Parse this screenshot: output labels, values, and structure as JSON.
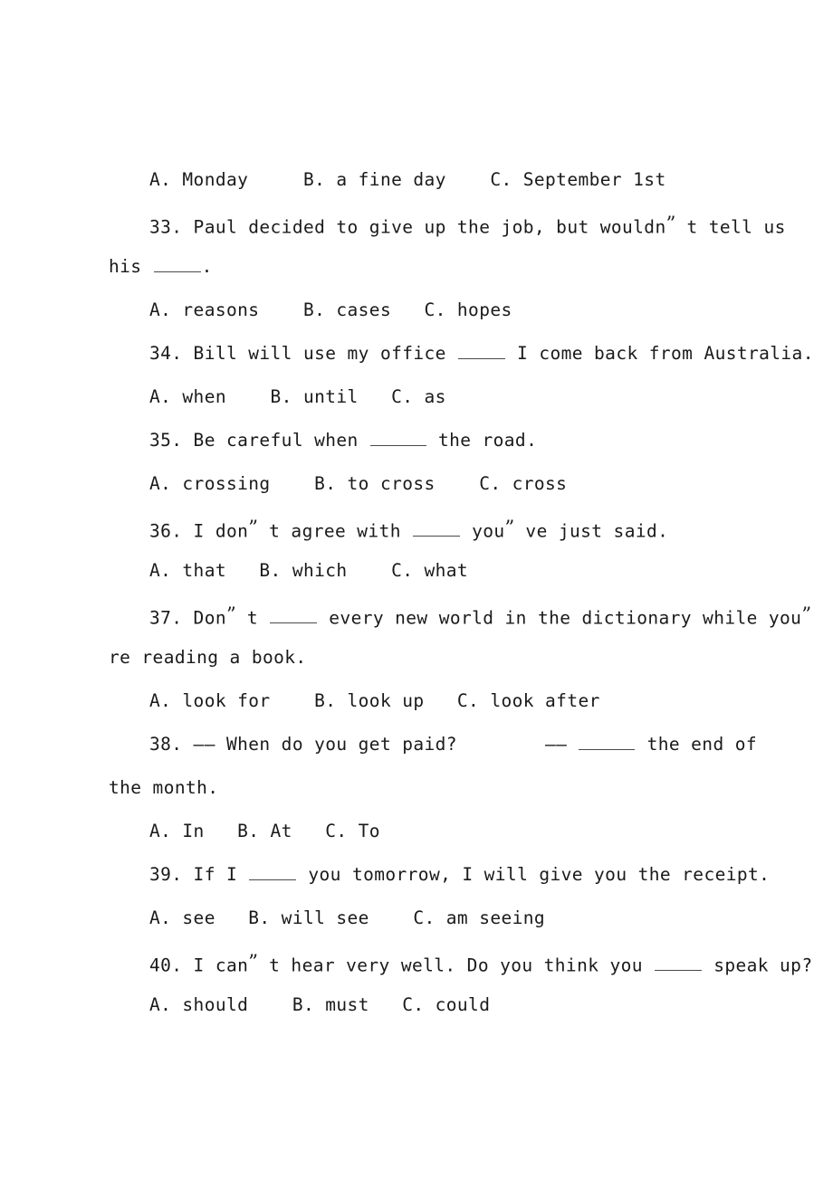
{
  "document": {
    "type": "english-multiple-choice-exam",
    "lines": [
      {
        "id": "q32-options",
        "kind": "options",
        "indent": "indent",
        "text": "A. Monday     B. a fine day    C. September 1st"
      },
      {
        "id": "q33-stem-1",
        "kind": "question",
        "indent": "indent",
        "number": "33.",
        "pre": "33. Paul decided to give up the job, but wouldn",
        "quote": "”",
        "post": " t tell us"
      },
      {
        "id": "q33-stem-2",
        "kind": "question-continuation",
        "indent": "flush",
        "pre": "his ",
        "blank": "w4",
        "post": "."
      },
      {
        "id": "q33-options",
        "kind": "options",
        "indent": "indent",
        "text": "A. reasons    B. cases   C. hopes"
      },
      {
        "id": "q34-stem",
        "kind": "question",
        "indent": "indent",
        "pre": "34. Bill will use my office ",
        "blank": "w4",
        "post": " I come back from Australia."
      },
      {
        "id": "q34-options",
        "kind": "options",
        "indent": "indent",
        "text": "A. when    B. until   C. as"
      },
      {
        "id": "q35-stem",
        "kind": "question",
        "indent": "indent",
        "pre": "35. Be careful when ",
        "blank": "w5",
        "post": " the road."
      },
      {
        "id": "q35-options",
        "kind": "options",
        "indent": "indent",
        "text": "A. crossing    B. to cross    C. cross"
      },
      {
        "id": "q36-stem",
        "kind": "question",
        "indent": "indent",
        "pre": "36. I don” t agree with ",
        "blank": "w4",
        "post": " you” ve just said."
      },
      {
        "id": "q36-options",
        "kind": "options",
        "indent": "indent",
        "text": "A. that   B. which    C. what"
      },
      {
        "id": "q37-stem-1",
        "kind": "question",
        "indent": "indent",
        "pre": "37. Don” t ",
        "blank": "w4",
        "post": " every new world in the dictionary while you”"
      },
      {
        "id": "q37-stem-2",
        "kind": "question-continuation",
        "indent": "flush",
        "text": "re reading a book."
      },
      {
        "id": "q37-options",
        "kind": "options",
        "indent": "indent",
        "text": "A. look for    B. look up   C. look after"
      },
      {
        "id": "q38-stem-1",
        "kind": "question",
        "indent": "indent",
        "pre": "38. —— When do you get paid?        —— ",
        "blank": "w5",
        "post": " the end of"
      },
      {
        "id": "q38-stem-2",
        "kind": "question-continuation",
        "indent": "flush",
        "text": "the month."
      },
      {
        "id": "q38-options",
        "kind": "options",
        "indent": "indent",
        "text": "A. In   B. At   C. To"
      },
      {
        "id": "q39-stem",
        "kind": "question",
        "indent": "indent",
        "pre": "39. If I ",
        "blank": "w4",
        "post": " you tomorrow, I will give you the receipt."
      },
      {
        "id": "q39-options",
        "kind": "options",
        "indent": "indent",
        "text": "A. see   B. will see    C. am seeing"
      },
      {
        "id": "q40-stem",
        "kind": "question",
        "indent": "indent",
        "pre": "40. I can” t hear very well. Do you think you ",
        "blank": "w4",
        "post": " speak up?"
      },
      {
        "id": "q40-options",
        "kind": "options",
        "indent": "indent",
        "text": "A. should    B. must   C. could"
      }
    ]
  }
}
